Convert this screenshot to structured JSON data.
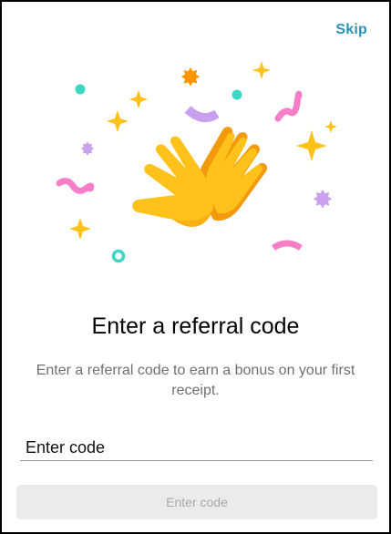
{
  "header": {
    "skip_label": "Skip"
  },
  "illustration": {
    "icon": "clapping-hands-with-confetti",
    "colors": {
      "hand": "#ffc21a",
      "hand_shadow": "#f29a0c",
      "confetti_teal": "#3cd6c4",
      "confetti_purple": "#c9a0ee",
      "confetti_pink": "#f57ec7",
      "sparkle_gold": "#ffc21a",
      "sparkle_orange": "#ff9500"
    }
  },
  "main": {
    "title": "Enter a referral code",
    "subtitle": "Enter a referral code to earn a bonus on your first receipt."
  },
  "form": {
    "code_placeholder": "Enter code",
    "submit_label": "Enter code"
  },
  "colors": {
    "accent": "#2a93b4",
    "button_disabled_bg": "#ebebeb",
    "button_disabled_text": "#a8a8a8"
  }
}
